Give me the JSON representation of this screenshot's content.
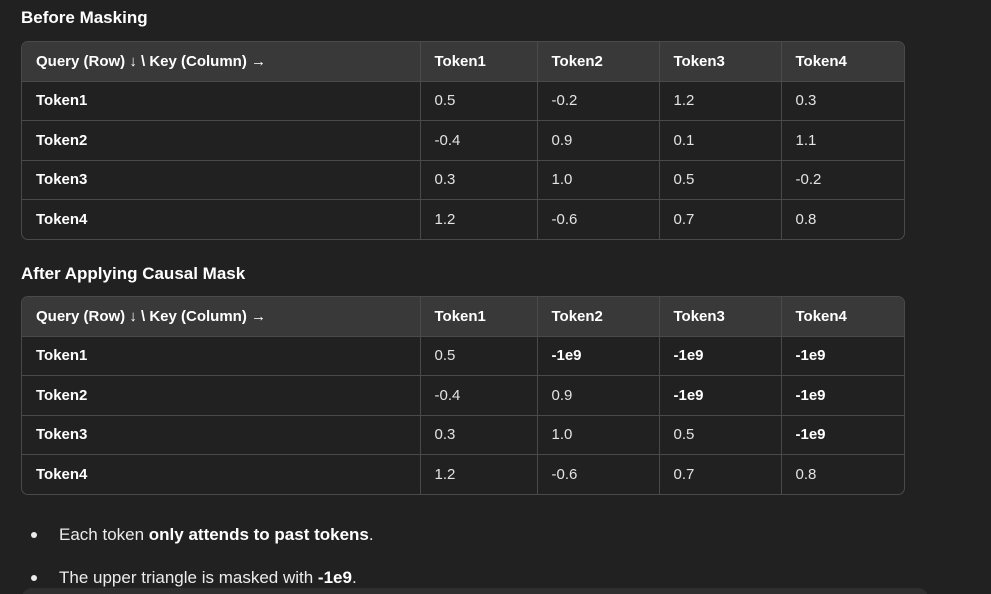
{
  "before": {
    "heading": "Before Masking",
    "columns": [
      "Query (Row) ↓ \\ Key (Column) →",
      "Token1",
      "Token2",
      "Token3",
      "Token4"
    ],
    "rows": [
      [
        "Token1",
        "0.5",
        "-0.2",
        "1.2",
        "0.3"
      ],
      [
        "Token2",
        "-0.4",
        "0.9",
        "0.1",
        "1.1"
      ],
      [
        "Token3",
        "0.3",
        "1.0",
        "0.5",
        "-0.2"
      ],
      [
        "Token4",
        "1.2",
        "-0.6",
        "0.7",
        "0.8"
      ]
    ]
  },
  "after": {
    "heading": "After Applying Causal Mask",
    "columns": [
      "Query (Row) ↓ \\ Key (Column) →",
      "Token1",
      "Token2",
      "Token3",
      "Token4"
    ],
    "rows": [
      [
        "Token1",
        "0.5",
        "-1e9",
        "-1e9",
        "-1e9"
      ],
      [
        "Token2",
        "-0.4",
        "0.9",
        "-1e9",
        "-1e9"
      ],
      [
        "Token3",
        "0.3",
        "1.0",
        "0.5",
        "-1e9"
      ],
      [
        "Token4",
        "1.2",
        "-0.6",
        "0.7",
        "0.8"
      ]
    ]
  },
  "notes": [
    {
      "pre": "Each token ",
      "bold": "only attends to past tokens",
      "post": "."
    },
    {
      "pre": "The upper triangle is masked with ",
      "bold": "-1e9",
      "post": "."
    }
  ]
}
